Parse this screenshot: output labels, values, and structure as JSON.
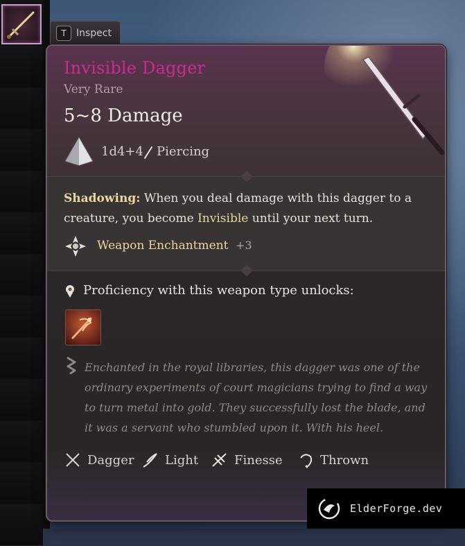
{
  "inspect_tab": {
    "key": "T",
    "label": "Inspect"
  },
  "item": {
    "name": "Invisible Dagger",
    "rarity": "Very Rare",
    "damage": "5~8 Damage",
    "dice": "1d4+4",
    "damage_type": "Piercing",
    "name_color": "#d02a8c"
  },
  "effect": {
    "name": "Shadowing:",
    "text_before": " When you deal damage with this dagger to a creature, you become ",
    "keyword": "Invisible",
    "text_after": " until your next turn."
  },
  "enchantment": {
    "label": "Weapon Enchantment",
    "bonus": "+3"
  },
  "proficiency": {
    "text": "Proficiency with this weapon type unlocks:"
  },
  "lore": "Enchanted in the royal libraries, this dagger was one of the ordinary experiments of court magicians trying to find a way to turn metal into gold. They successfully lost the blade, and it was a servant who stumbled upon it. With his heel.",
  "tags": [
    {
      "label": "Dagger",
      "icon": "dagger-icon"
    },
    {
      "label": "Light",
      "icon": "feather-icon"
    },
    {
      "label": "Finesse",
      "icon": "finesse-icon"
    },
    {
      "label": "Thrown",
      "icon": "thrown-icon"
    }
  ],
  "watermark": {
    "text": "ElderForge.dev"
  }
}
